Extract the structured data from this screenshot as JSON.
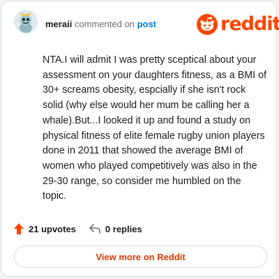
{
  "comment": {
    "username": "meraii",
    "action_text": "commented on",
    "target_link": "post",
    "body": "NTA.I will admit I was pretty sceptical about your assessment on your daughters fitness, as a BMI of 30+ screams obesity, espcially if she isn't rock solid (why else would her mum be calling her a whale).But...I looked it up and found a study on physical fitness of elite female rugby union players done in 2011 that showed the average BMI of women who played competitively was also in the 29-30 range, so consider me humbled on the topic.",
    "upvotes_label": "21 upvotes",
    "replies_label": "0 replies"
  },
  "brand": {
    "wordmark": "reddit"
  },
  "footer": {
    "view_label": "View more on Reddit"
  },
  "icons": {
    "avatar": "snoo-avatar-icon",
    "logo": "reddit-alien-icon",
    "upvote": "upvote-arrow-icon",
    "reply": "reply-arrow-icon"
  },
  "colors": {
    "brand": "#ff4500",
    "link": "#0079d3",
    "view_more_text": "#d93a00"
  }
}
